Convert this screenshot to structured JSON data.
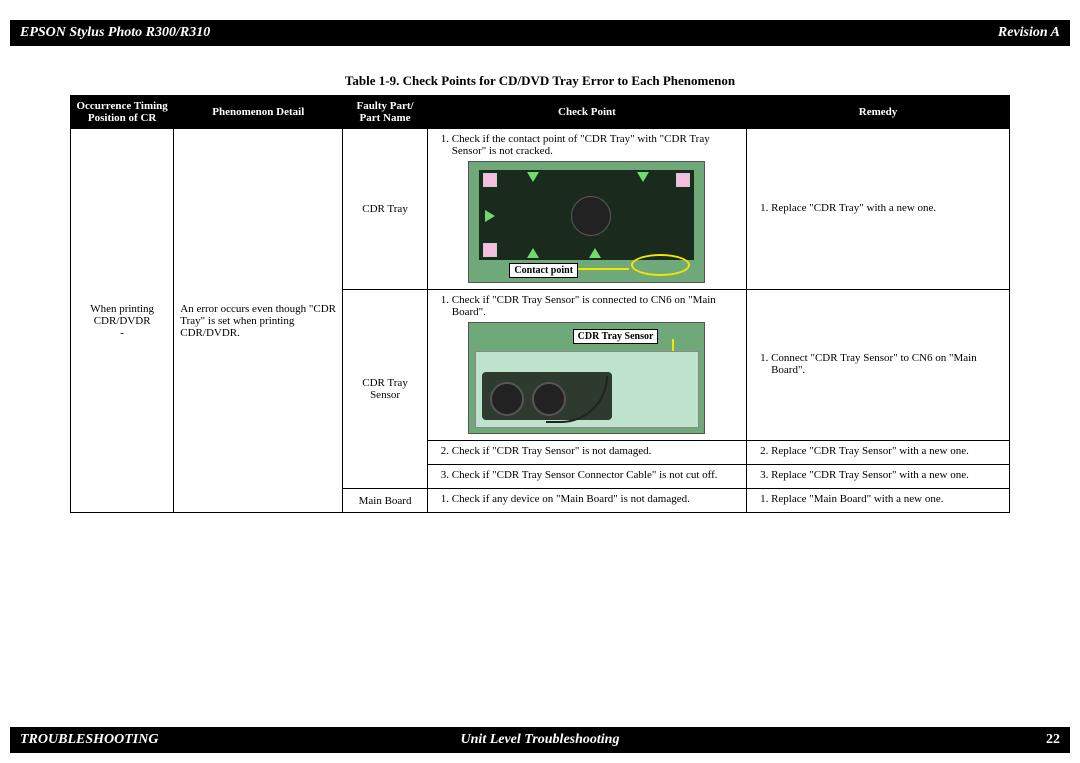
{
  "header": {
    "left": "EPSON Stylus Photo R300/R310",
    "right": "Revision A"
  },
  "footer": {
    "left": "TROUBLESHOOTING",
    "center": "Unit Level Troubleshooting",
    "right": "22"
  },
  "table_caption": "Table 1-9.  Check Points for CD/DVD Tray Error to Each Phenomenon",
  "columns": {
    "c1": "Occurrence Timing\nPosition of CR",
    "c2": "Phenomenon Detail",
    "c3": "Faulty Part/\nPart Name",
    "c4": "Check Point",
    "c5": "Remedy"
  },
  "occurrence": "When printing CDR/DVDR\n-",
  "phenomenon": "An error occurs even though \"CDR Tray\" is set when printing CDR/DVDR.",
  "parts": {
    "p1": "CDR Tray",
    "p2": "CDR Tray Sensor",
    "p3": "Main Board"
  },
  "labels": {
    "contact_point": "Contact point",
    "cdr_tray_sensor": "CDR Tray Sensor"
  },
  "check": {
    "r1_1": "Check if the contact point of \"CDR Tray\" with \"CDR Tray Sensor\" is not cracked.",
    "r2_1": "Check if \"CDR Tray Sensor\" is connected to CN6 on \"Main Board\".",
    "r2_2": "Check if \"CDR Tray Sensor\" is not damaged.",
    "r2_3": "Check if \"CDR Tray Sensor Connector Cable\" is not cut off.",
    "r3_1": "Check if any device on \"Main Board\" is not damaged."
  },
  "remedy": {
    "r1_1": "Replace \"CDR Tray\" with a new one.",
    "r2_1": "Connect \"CDR Tray Sensor\" to CN6 on \"Main Board\".",
    "r2_2": "Replace \"CDR Tray Sensor\" with a new one.",
    "r2_3": "Replace \"CDR Tray Sensor\" with a new one.",
    "r3_1": "Replace \"Main Board\" with a new one."
  }
}
